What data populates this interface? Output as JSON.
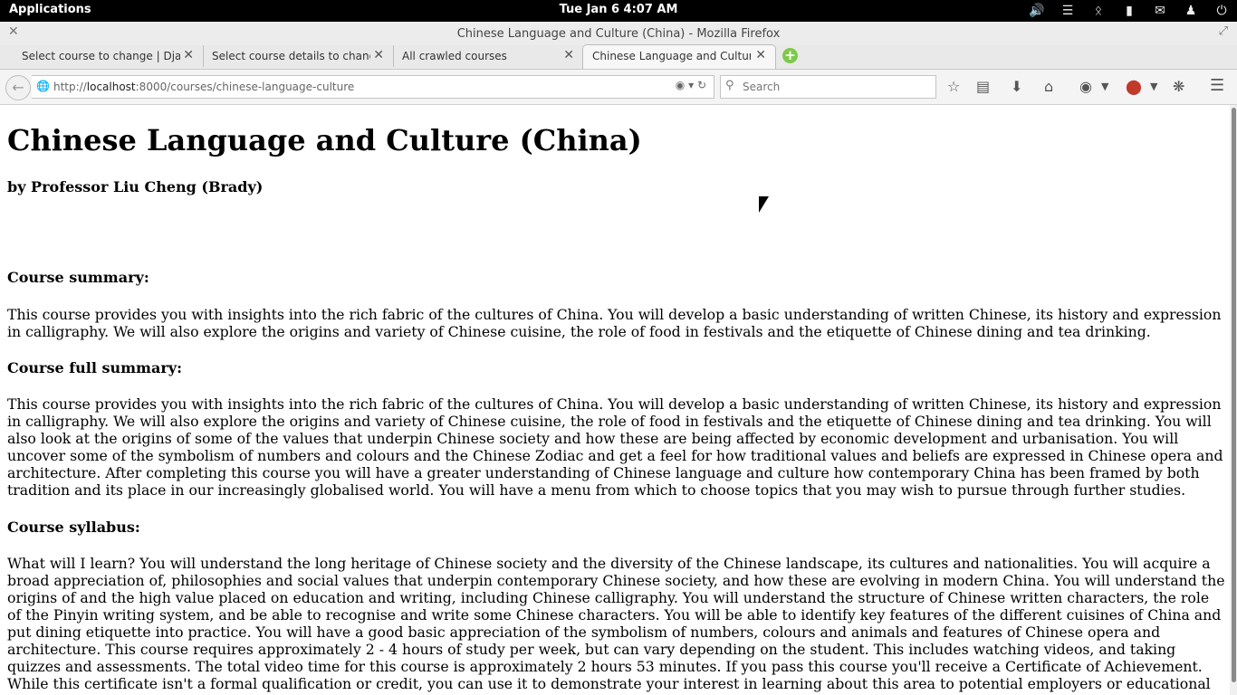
{
  "system_panel": {
    "applications_label": "Applications",
    "clock": "Tue Jan  6  4:07 AM",
    "tray_icons": [
      "volume-icon",
      "wifi-icon",
      "bluetooth-icon",
      "battery-icon",
      "mail-icon",
      "user-icon",
      "power-icon"
    ]
  },
  "window": {
    "title": "Chinese Language and Culture (China) - Mozilla Firefox"
  },
  "tabs": [
    {
      "label": "Select course to change | Djan...",
      "active": false
    },
    {
      "label": "Select course details to change...",
      "active": false
    },
    {
      "label": "All crawled courses",
      "active": false
    },
    {
      "label": "Chinese Language and Culture ...",
      "active": true
    }
  ],
  "nav": {
    "url_prefix": "http://",
    "url_host": "localhost",
    "url_rest": ":8000/courses/chinese-language-culture",
    "search_placeholder": "Search"
  },
  "page": {
    "heading": "Chinese Language and Culture (China)",
    "byline": "by Professor Liu Cheng (Brady)",
    "summary_heading": "Course summary:",
    "summary_text": "This course provides you with insights into the rich fabric of the cultures of China. You will develop a basic understanding of written Chinese, its history and expression in calligraphy. We will also explore the origins and variety of Chinese cuisine, the role of food in festivals and the etiquette of Chinese dining and tea drinking.",
    "full_summary_heading": "Course full summary:",
    "full_summary_text": "This course provides you with insights into the rich fabric of the cultures of China. You will develop a basic understanding of written Chinese, its history and expression in calligraphy. We will also explore the origins and variety of Chinese cuisine, the role of food in festivals and the etiquette of Chinese dining and tea drinking. You will also look at the origins of some of the values that underpin Chinese society and how these are being affected by economic development and urbanisation. You will uncover some of the symbolism of numbers and colours and the Chinese Zodiac and get a feel for how traditional values and beliefs are expressed in Chinese opera and architecture. After completing this course you will have a greater understanding of Chinese language and culture how contemporary China has been framed by both tradition and its place in our increasingly globalised world. You will have a menu from which to choose topics that you may wish to pursue through further studies.",
    "syllabus_heading": "Course syllabus:",
    "syllabus_text": "What will I learn? You will understand the long heritage of Chinese society and the diversity of the Chinese landscape, its cultures and nationalities. You will acquire a broad appreciation of, philosophies and social values that underpin contemporary Chinese society, and how these are evolving in modern China. You will understand the origins of and the high value placed on education and writing, including Chinese calligraphy. You will understand the structure of Chinese written characters, the role of the Pinyin writing system, and be able to recognise and write some Chinese characters. You will be able to identify key features of the different cuisines of China and put dining etiquette into practice. You will have a good basic appreciation of the symbolism of numbers, colours and animals and features of Chinese opera and architecture. This course requires approximately 2 - 4 hours of study per week, but can vary depending on the student. This includes watching videos, and taking quizzes and assessments. The total video time for this course is approximately 2 hours 53 minutes. If you pass this course you'll receive a Certificate of Achievement. While this certificate isn't a formal qualification or credit, you can use it to demonstrate your interest in learning about this area to potential employers or educational institutions."
  }
}
